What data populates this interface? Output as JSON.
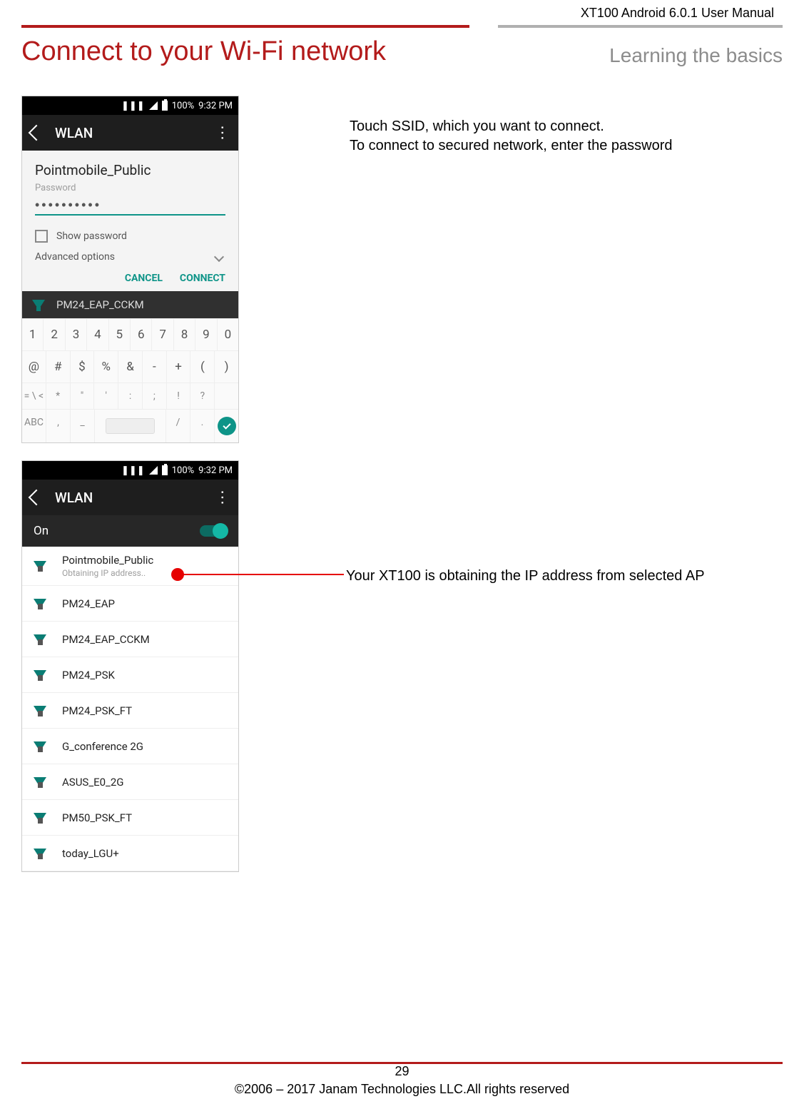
{
  "doc_header": "XT100 Android 6.0.1 User Manual",
  "title_left": "Connect to your Wi-Fi network",
  "title_right": "Learning the basics",
  "instruction1": "Touch SSID, which you want to connect.",
  "instruction2": "To connect to secured network, enter the password",
  "callout_text": "Your XT100 is obtaining the IP address from selected AP",
  "page_number": "29",
  "copyright": "©2006 – 2017 Janam Technologies LLC.All rights reserved",
  "phone1": {
    "status": {
      "battery": "100%",
      "time": "9:32 PM"
    },
    "appbar": {
      "title": "WLAN"
    },
    "dialog": {
      "ssid": "Pointmobile_Public",
      "password_label": "Password",
      "password_value": "••••••••••",
      "show_password": "Show password",
      "advanced": "Advanced options",
      "cancel": "CANCEL",
      "connect": "CONNECT"
    },
    "bg_network": "PM24_EAP_CCKM",
    "keyboard": {
      "row1": [
        "1",
        "2",
        "3",
        "4",
        "5",
        "6",
        "7",
        "8",
        "9",
        "0"
      ],
      "row2": [
        "@",
        "#",
        "$",
        "%",
        "&",
        "-",
        "+",
        "(",
        ")"
      ],
      "row3": [
        "= \\ <",
        "*",
        "\"",
        "'",
        ":",
        ";",
        "!",
        "?",
        "⌫"
      ],
      "row4_abc": "ABC",
      "row4_comma": ",",
      "row4_under": "_",
      "row4_slash": "/",
      "row4_dot": "."
    }
  },
  "phone2": {
    "status": {
      "battery": "100%",
      "time": "9:32 PM"
    },
    "appbar": {
      "title": "WLAN"
    },
    "on_label": "On",
    "networks": [
      {
        "name": "Pointmobile_Public",
        "sub": "Obtaining IP address..",
        "locked": true
      },
      {
        "name": "PM24_EAP",
        "locked": true
      },
      {
        "name": "PM24_EAP_CCKM",
        "locked": true
      },
      {
        "name": "PM24_PSK",
        "locked": true
      },
      {
        "name": "PM24_PSK_FT",
        "locked": true
      },
      {
        "name": "G_conference 2G",
        "locked": true
      },
      {
        "name": "ASUS_E0_2G",
        "locked": true
      },
      {
        "name": "PM50_PSK_FT",
        "locked": true
      },
      {
        "name": "today_LGU+",
        "locked": true
      }
    ]
  }
}
